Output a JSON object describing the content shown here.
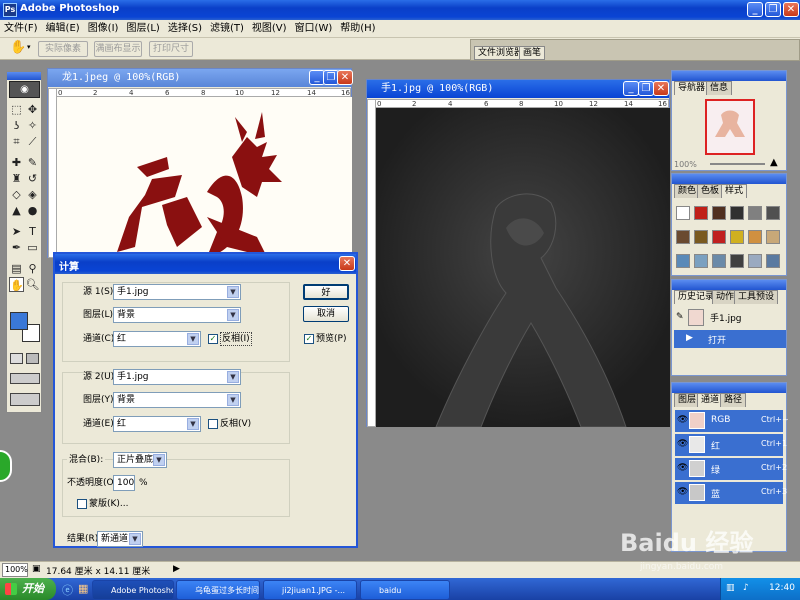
{
  "app": {
    "title": "Adobe Photoshop"
  },
  "menu": [
    "文件(F)",
    "编辑(E)",
    "图像(I)",
    "图层(L)",
    "选择(S)",
    "滤镜(T)",
    "视图(V)",
    "窗口(W)",
    "帮助(H)"
  ],
  "options": {
    "btn1": "实际像素",
    "btn2": "满画布显示",
    "btn3": "打印尺寸",
    "well_tab1": "文件浏览器",
    "well_tab2": "画笔"
  },
  "doc1": {
    "title": "龙1.jpeg @ 100%(RGB)",
    "ruler": [
      "0",
      "2",
      "4",
      "6",
      "8",
      "10",
      "12",
      "14",
      "16"
    ]
  },
  "doc2": {
    "title": "手1.jpg @ 100%(RGB)",
    "ruler": [
      "0",
      "2",
      "4",
      "6",
      "8",
      "10",
      "12",
      "14",
      "16"
    ]
  },
  "dialog": {
    "title": "计算",
    "src1_label": "源 1(S):",
    "src1_value": "手1.jpg",
    "layer1_label": "图层(L):",
    "layer1_value": "背景",
    "channel1_label": "通道(C):",
    "channel1_value": "红",
    "invert1_label": "反相(I)",
    "invert1_checked": true,
    "src2_label": "源 2(U):",
    "src2_value": "手1.jpg",
    "layer2_label": "图层(Y):",
    "layer2_value": "背景",
    "channel2_label": "通道(E):",
    "channel2_value": "红",
    "invert2_label": "反相(V)",
    "invert2_checked": false,
    "blend_label": "混合(B):",
    "blend_value": "正片叠底",
    "opacity_label": "不透明度(O):",
    "opacity_value": "100",
    "opacity_unit": "%",
    "mask_label": "蒙版(K)...",
    "result_label": "结果(R):",
    "result_value": "新通道",
    "ok": "好",
    "cancel": "取消",
    "preview_label": "预览(P)",
    "preview_checked": true
  },
  "navigator": {
    "tabs": [
      "导航器",
      "信息"
    ],
    "zoom": "100%"
  },
  "color_panel": {
    "tabs": [
      "颜色",
      "色板",
      "样式"
    ]
  },
  "history": {
    "tabs": [
      "历史记录",
      "动作",
      "工具预设"
    ],
    "snapshot": "手1.jpg",
    "step": "打开"
  },
  "channels": {
    "tabs": [
      "图层",
      "通道",
      "路径"
    ],
    "rows": [
      {
        "name": "RGB",
        "shortcut": "Ctrl+~"
      },
      {
        "name": "红",
        "shortcut": "Ctrl+1"
      },
      {
        "name": "绿",
        "shortcut": "Ctrl+2"
      },
      {
        "name": "蓝",
        "shortcut": "Ctrl+3"
      }
    ]
  },
  "status": {
    "zoom": "100%",
    "size": "17.64 厘米 x 14.11 厘米"
  },
  "taskbar": {
    "start": "开始",
    "items": [
      "Adobe Photoshop",
      "乌龟蛋过多长时间...",
      "ji2jiuan1.JPG -...",
      "baidu"
    ],
    "clock": "12:40"
  },
  "watermark": {
    "logo": "Baidu 经验",
    "url": "jingyan.baidu.com"
  },
  "colors": {
    "xp_blue": "#0a44d4",
    "dialog_bg": "#ece9d8",
    "selection": "#3a6fd0"
  }
}
